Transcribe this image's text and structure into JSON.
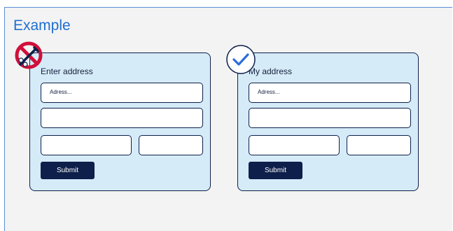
{
  "title": "Example",
  "colors": {
    "title": "#1f6fd1",
    "card_bg": "#d6ebf8",
    "border": "#0d1f4a",
    "error": "#d0103a",
    "check": "#2b6ed6"
  },
  "left_card": {
    "label": "Enter address",
    "placeholder": "Adress...",
    "submit_label": "Submit",
    "badge_icon": "no-pen-icon"
  },
  "right_card": {
    "label": "My address",
    "placeholder": "Adress...",
    "submit_label": "Submit",
    "badge_icon": "check-circle-icon"
  }
}
